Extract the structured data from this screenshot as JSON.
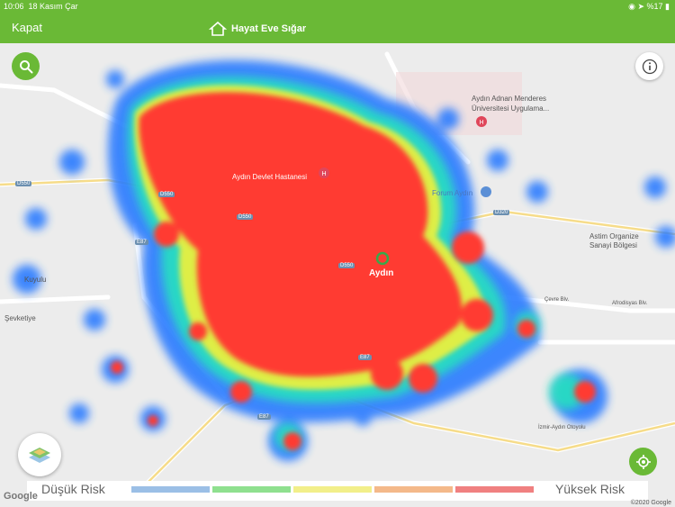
{
  "status": {
    "time": "10:06",
    "date": "18 Kasım Çar",
    "battery": "%17"
  },
  "nav": {
    "close_label": "Kapat",
    "brand": "Hayat Eve Sığar"
  },
  "map": {
    "places": {
      "university": "Aydın Adnan Menderes",
      "university2": "Üniversitesi Uygulama...",
      "hospital": "Aydın Devlet Hastanesi",
      "forum": "Forum Aydın",
      "asti": "Astim Organize",
      "asti2": "Sanayi Bölgesi",
      "city": "Aydın",
      "kuyulu": "Kuyulu",
      "sevketiye": "Şevketiye",
      "cevre": "Çevre Blv.",
      "afrodisyas": "Afrodisyas Blv.",
      "otoyolu": "İzmir-Aydın Otoyolu"
    },
    "roads": {
      "d550a": "D550",
      "d550b": "D550",
      "d550c": "D550",
      "d550d": "D550",
      "d320": "D320",
      "e87a": "E87",
      "e87b": "E87",
      "e87c": "E87"
    }
  },
  "legend": {
    "low": "Düşük Risk",
    "high": "Yüksek Risk",
    "colors": [
      "#9bbfe6",
      "#8fe08f",
      "#f2ef8a",
      "#f4b98a",
      "#f08080"
    ]
  },
  "attribution": {
    "google": "Google",
    "copyright": "©2020 Google"
  },
  "colors": {
    "brand": "#6ab936",
    "hot": "#ff3b30"
  }
}
